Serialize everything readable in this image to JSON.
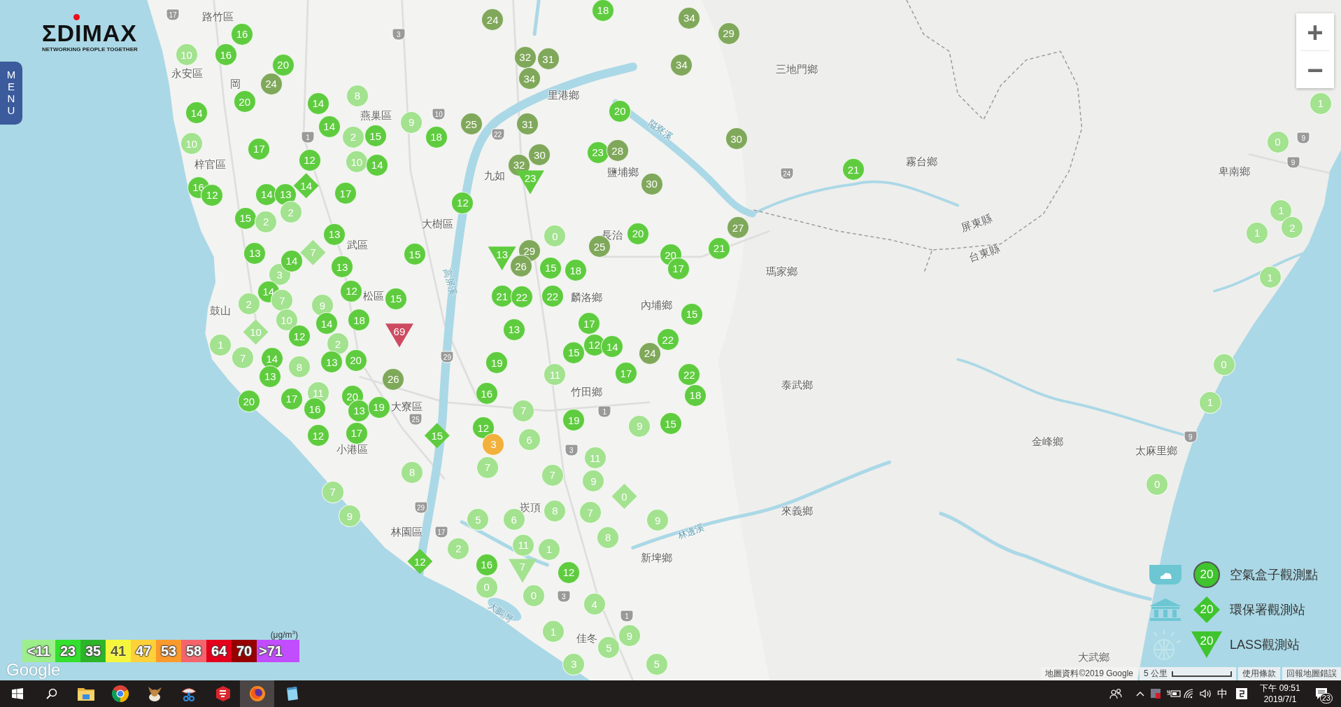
{
  "map": {
    "logo": {
      "wordmark": "ΣDIMAX",
      "tagline": "NETWORKING PEOPLE TOGETHER"
    },
    "menu_button": "MENU",
    "zoom": {
      "in": "+",
      "out": "−"
    },
    "place_labels": [
      "路竹區",
      "永安區",
      "岡",
      "燕巢區",
      "梓官區",
      "九如",
      "里港鄉",
      "鹽埔鄉",
      "三地門鄉",
      "霧台鄉",
      "卑南鄉",
      "大樹區",
      "武區",
      "長治",
      "瑪家鄉",
      "松區",
      "麟洛鄉",
      "內埔鄉",
      "鼓山",
      "泰武鄉",
      "竹田鄉",
      "大寮區",
      "小港區",
      "金峰鄉",
      "太麻里鄉",
      "來義鄉",
      "崁頂",
      "林園區",
      "新埤鄉",
      "佳冬",
      "大武鄉",
      "屏東縣",
      "台東縣"
    ],
    "water_labels": [
      "隘寮溪",
      "林邊溪",
      "大鵬灣",
      "高屏溪"
    ],
    "road_shields": [
      "17",
      "3",
      "10",
      "22",
      "1",
      "24",
      "9",
      "9",
      "29",
      "25",
      "29",
      "17",
      "1",
      "3",
      "1",
      "3",
      "9"
    ],
    "markers": [
      {
        "kind": "circle",
        "value": "16",
        "color": "#5fcc3f"
      },
      {
        "kind": "circle",
        "value": "24",
        "color": "#80a85b"
      },
      {
        "kind": "circle",
        "value": "18",
        "color": "#5fcc3f"
      },
      {
        "kind": "circle",
        "value": "34",
        "color": "#80a85b"
      },
      {
        "kind": "circle",
        "value": "29",
        "color": "#80a85b"
      },
      {
        "kind": "circle",
        "value": "10",
        "color": "#a3e28f"
      },
      {
        "kind": "circle",
        "value": "16",
        "color": "#5fcc3f"
      },
      {
        "kind": "circle",
        "value": "20",
        "color": "#5fcc3f"
      },
      {
        "kind": "circle",
        "value": "32",
        "color": "#80a85b"
      },
      {
        "kind": "circle",
        "value": "31",
        "color": "#80a85b"
      },
      {
        "kind": "circle",
        "value": "34",
        "color": "#80a85b"
      },
      {
        "kind": "circle",
        "value": "24",
        "color": "#80a85b"
      },
      {
        "kind": "circle",
        "value": "34",
        "color": "#80a85b"
      },
      {
        "kind": "circle",
        "value": "20",
        "color": "#5fcc3f"
      },
      {
        "kind": "circle",
        "value": "14",
        "color": "#5fcc3f"
      },
      {
        "kind": "circle",
        "value": "8",
        "color": "#a3e28f"
      },
      {
        "kind": "circle",
        "value": "14",
        "color": "#5fcc3f"
      },
      {
        "kind": "circle",
        "value": "10",
        "color": "#a3e28f"
      },
      {
        "kind": "circle",
        "value": "14",
        "color": "#5fcc3f"
      },
      {
        "kind": "circle",
        "value": "2",
        "color": "#a3e28f"
      },
      {
        "kind": "circle",
        "value": "15",
        "color": "#5fcc3f"
      },
      {
        "kind": "circle",
        "value": "9",
        "color": "#a3e28f"
      },
      {
        "kind": "circle",
        "value": "18",
        "color": "#5fcc3f"
      },
      {
        "kind": "circle",
        "value": "25",
        "color": "#80a85b"
      },
      {
        "kind": "circle",
        "value": "31",
        "color": "#80a85b"
      },
      {
        "kind": "circle",
        "value": "20",
        "color": "#5fcc3f"
      },
      {
        "kind": "circle",
        "value": "30",
        "color": "#80a85b"
      },
      {
        "kind": "circle",
        "value": "17",
        "color": "#5fcc3f"
      },
      {
        "kind": "circle",
        "value": "12",
        "color": "#5fcc3f"
      },
      {
        "kind": "circle",
        "value": "10",
        "color": "#a3e28f"
      },
      {
        "kind": "circle",
        "value": "14",
        "color": "#5fcc3f"
      },
      {
        "kind": "circle",
        "value": "32",
        "color": "#80a85b"
      },
      {
        "kind": "circle",
        "value": "30",
        "color": "#80a85b"
      },
      {
        "kind": "circle",
        "value": "23",
        "color": "#5fcc3f"
      },
      {
        "kind": "circle",
        "value": "28",
        "color": "#80a85b"
      },
      {
        "kind": "triangle",
        "value": "23",
        "color": "#5fcc3f"
      },
      {
        "kind": "circle",
        "value": "30",
        "color": "#80a85b"
      },
      {
        "kind": "circle",
        "value": "21",
        "color": "#5fcc3f"
      },
      {
        "kind": "circle",
        "value": "16",
        "color": "#5fcc3f"
      },
      {
        "kind": "circle",
        "value": "12",
        "color": "#5fcc3f"
      },
      {
        "kind": "circle",
        "value": "14",
        "color": "#5fcc3f"
      },
      {
        "kind": "circle",
        "value": "13",
        "color": "#5fcc3f"
      },
      {
        "kind": "diamond",
        "value": "14",
        "color": "#5fcc3f"
      },
      {
        "kind": "circle",
        "value": "17",
        "color": "#5fcc3f"
      },
      {
        "kind": "circle",
        "value": "12",
        "color": "#5fcc3f"
      },
      {
        "kind": "circle",
        "value": "15",
        "color": "#5fcc3f"
      },
      {
        "kind": "circle",
        "value": "2",
        "color": "#a3e28f"
      },
      {
        "kind": "circle",
        "value": "2",
        "color": "#a3e28f"
      },
      {
        "kind": "circle",
        "value": "13",
        "color": "#5fcc3f"
      },
      {
        "kind": "circle",
        "value": "0",
        "color": "#a3e28f"
      },
      {
        "kind": "circle",
        "value": "20",
        "color": "#5fcc3f"
      },
      {
        "kind": "circle",
        "value": "27",
        "color": "#80a85b"
      },
      {
        "kind": "circle",
        "value": "13",
        "color": "#5fcc3f"
      },
      {
        "kind": "circle",
        "value": "3",
        "color": "#a3e28f"
      },
      {
        "kind": "circle",
        "value": "14",
        "color": "#5fcc3f"
      },
      {
        "kind": "diamond",
        "value": "7",
        "color": "#a3e28f"
      },
      {
        "kind": "circle",
        "value": "13",
        "color": "#5fcc3f"
      },
      {
        "kind": "circle",
        "value": "15",
        "color": "#5fcc3f"
      },
      {
        "kind": "triangle",
        "value": "13",
        "color": "#5fcc3f"
      },
      {
        "kind": "circle",
        "value": "29",
        "color": "#80a85b"
      },
      {
        "kind": "circle",
        "value": "26",
        "color": "#80a85b"
      },
      {
        "kind": "circle",
        "value": "15",
        "color": "#5fcc3f"
      },
      {
        "kind": "circle",
        "value": "18",
        "color": "#5fcc3f"
      },
      {
        "kind": "circle",
        "value": "25",
        "color": "#80a85b"
      },
      {
        "kind": "circle",
        "value": "20",
        "color": "#5fcc3f"
      },
      {
        "kind": "circle",
        "value": "17",
        "color": "#5fcc3f"
      },
      {
        "kind": "circle",
        "value": "21",
        "color": "#5fcc3f"
      },
      {
        "kind": "circle",
        "value": "2",
        "color": "#a3e28f"
      },
      {
        "kind": "circle",
        "value": "14",
        "color": "#5fcc3f"
      },
      {
        "kind": "circle",
        "value": "7",
        "color": "#a3e28f"
      },
      {
        "kind": "circle",
        "value": "9",
        "color": "#a3e28f"
      },
      {
        "kind": "circle",
        "value": "12",
        "color": "#5fcc3f"
      },
      {
        "kind": "circle",
        "value": "15",
        "color": "#5fcc3f"
      },
      {
        "kind": "circle",
        "value": "21",
        "color": "#5fcc3f"
      },
      {
        "kind": "circle",
        "value": "22",
        "color": "#5fcc3f"
      },
      {
        "kind": "circle",
        "value": "22",
        "color": "#5fcc3f"
      },
      {
        "kind": "circle",
        "value": "10",
        "color": "#a3e28f"
      },
      {
        "kind": "circle",
        "value": "14",
        "color": "#5fcc3f"
      },
      {
        "kind": "circle",
        "value": "18",
        "color": "#5fcc3f"
      },
      {
        "kind": "triangle",
        "value": "69",
        "color": "#cd4a60"
      },
      {
        "kind": "circle",
        "value": "13",
        "color": "#5fcc3f"
      },
      {
        "kind": "circle",
        "value": "17",
        "color": "#5fcc3f"
      },
      {
        "kind": "circle",
        "value": "15",
        "color": "#5fcc3f"
      },
      {
        "kind": "circle",
        "value": "1",
        "color": "#a3e28f"
      },
      {
        "kind": "circle",
        "value": "7",
        "color": "#a3e28f"
      },
      {
        "kind": "diamond",
        "value": "10",
        "color": "#a3e28f"
      },
      {
        "kind": "circle",
        "value": "14",
        "color": "#5fcc3f"
      },
      {
        "kind": "circle",
        "value": "12",
        "color": "#5fcc3f"
      },
      {
        "kind": "circle",
        "value": "8",
        "color": "#a3e28f"
      },
      {
        "kind": "circle",
        "value": "2",
        "color": "#a3e28f"
      },
      {
        "kind": "circle",
        "value": "13",
        "color": "#5fcc3f"
      },
      {
        "kind": "circle",
        "value": "20",
        "color": "#5fcc3f"
      },
      {
        "kind": "circle",
        "value": "19",
        "color": "#5fcc3f"
      },
      {
        "kind": "circle",
        "value": "15",
        "color": "#5fcc3f"
      },
      {
        "kind": "circle",
        "value": "12",
        "color": "#5fcc3f"
      },
      {
        "kind": "circle",
        "value": "14",
        "color": "#5fcc3f"
      },
      {
        "kind": "circle",
        "value": "24",
        "color": "#80a85b"
      },
      {
        "kind": "circle",
        "value": "22",
        "color": "#5fcc3f"
      },
      {
        "kind": "circle",
        "value": "13",
        "color": "#5fcc3f"
      },
      {
        "kind": "circle",
        "value": "26",
        "color": "#80a85b"
      },
      {
        "kind": "circle",
        "value": "11",
        "color": "#a3e28f"
      },
      {
        "kind": "circle",
        "value": "17",
        "color": "#5fcc3f"
      },
      {
        "kind": "circle",
        "value": "22",
        "color": "#5fcc3f"
      },
      {
        "kind": "circle",
        "value": "20",
        "color": "#5fcc3f"
      },
      {
        "kind": "circle",
        "value": "17",
        "color": "#5fcc3f"
      },
      {
        "kind": "circle",
        "value": "11",
        "color": "#a3e28f"
      },
      {
        "kind": "circle",
        "value": "16",
        "color": "#5fcc3f"
      },
      {
        "kind": "circle",
        "value": "20",
        "color": "#5fcc3f"
      },
      {
        "kind": "circle",
        "value": "13",
        "color": "#5fcc3f"
      },
      {
        "kind": "circle",
        "value": "19",
        "color": "#5fcc3f"
      },
      {
        "kind": "circle",
        "value": "16",
        "color": "#5fcc3f"
      },
      {
        "kind": "circle",
        "value": "7",
        "color": "#a3e28f"
      },
      {
        "kind": "circle",
        "value": "18",
        "color": "#5fcc3f"
      },
      {
        "kind": "circle",
        "value": "12",
        "color": "#5fcc3f"
      },
      {
        "kind": "circle",
        "value": "17",
        "color": "#5fcc3f"
      },
      {
        "kind": "diamond",
        "value": "15",
        "color": "#5fcc3f"
      },
      {
        "kind": "circle",
        "value": "12",
        "color": "#5fcc3f"
      },
      {
        "kind": "circle",
        "value": "3",
        "color": "#f2b03c"
      },
      {
        "kind": "circle",
        "value": "6",
        "color": "#a3e28f"
      },
      {
        "kind": "circle",
        "value": "19",
        "color": "#5fcc3f"
      },
      {
        "kind": "circle",
        "value": "9",
        "color": "#a3e28f"
      },
      {
        "kind": "circle",
        "value": "15",
        "color": "#5fcc3f"
      },
      {
        "kind": "circle",
        "value": "11",
        "color": "#a3e28f"
      },
      {
        "kind": "circle",
        "value": "8",
        "color": "#a3e28f"
      },
      {
        "kind": "circle",
        "value": "7",
        "color": "#a3e28f"
      },
      {
        "kind": "circle",
        "value": "7",
        "color": "#a3e28f"
      },
      {
        "kind": "circle",
        "value": "9",
        "color": "#a3e28f"
      },
      {
        "kind": "circle",
        "value": "7",
        "color": "#a3e28f"
      },
      {
        "kind": "diamond",
        "value": "0",
        "color": "#a3e28f"
      },
      {
        "kind": "circle",
        "value": "9",
        "color": "#a3e28f"
      },
      {
        "kind": "circle",
        "value": "5",
        "color": "#a3e28f"
      },
      {
        "kind": "circle",
        "value": "6",
        "color": "#a3e28f"
      },
      {
        "kind": "circle",
        "value": "8",
        "color": "#a3e28f"
      },
      {
        "kind": "circle",
        "value": "7",
        "color": "#a3e28f"
      },
      {
        "kind": "circle",
        "value": "9",
        "color": "#a3e28f"
      },
      {
        "kind": "circle",
        "value": "2",
        "color": "#a3e28f"
      },
      {
        "kind": "circle",
        "value": "11",
        "color": "#a3e28f"
      },
      {
        "kind": "circle",
        "value": "1",
        "color": "#a3e28f"
      },
      {
        "kind": "circle",
        "value": "8",
        "color": "#a3e28f"
      },
      {
        "kind": "diamond",
        "value": "12",
        "color": "#5fcc3f"
      },
      {
        "kind": "circle",
        "value": "16",
        "color": "#5fcc3f"
      },
      {
        "kind": "triangle",
        "value": "7",
        "color": "#a3e28f"
      },
      {
        "kind": "circle",
        "value": "12",
        "color": "#5fcc3f"
      },
      {
        "kind": "circle",
        "value": "0",
        "color": "#a3e28f"
      },
      {
        "kind": "circle",
        "value": "0",
        "color": "#a3e28f"
      },
      {
        "kind": "circle",
        "value": "4",
        "color": "#a3e28f"
      },
      {
        "kind": "circle",
        "value": "1",
        "color": "#a3e28f"
      },
      {
        "kind": "circle",
        "value": "5",
        "color": "#a3e28f"
      },
      {
        "kind": "circle",
        "value": "9",
        "color": "#a3e28f"
      },
      {
        "kind": "circle",
        "value": "3",
        "color": "#a3e28f"
      },
      {
        "kind": "circle",
        "value": "5",
        "color": "#a3e28f"
      },
      {
        "kind": "circle",
        "value": "1",
        "color": "#a3e28f"
      },
      {
        "kind": "circle",
        "value": "0",
        "color": "#a3e28f"
      },
      {
        "kind": "circle",
        "value": "1",
        "color": "#a3e28f"
      },
      {
        "kind": "circle",
        "value": "1",
        "color": "#a3e28f"
      },
      {
        "kind": "circle",
        "value": "2",
        "color": "#a3e28f"
      },
      {
        "kind": "circle",
        "value": "1",
        "color": "#a3e28f"
      },
      {
        "kind": "circle",
        "value": "0",
        "color": "#a3e28f"
      },
      {
        "kind": "circle",
        "value": "1",
        "color": "#a3e28f"
      },
      {
        "kind": "circle",
        "value": "0",
        "color": "#a3e28f"
      }
    ],
    "scale_legend": {
      "unit": "(μg/m$^{3}$)",
      "levels": [
        {
          "label": "<11",
          "color": "#9cef8a"
        },
        {
          "label": "23",
          "color": "#34e02e"
        },
        {
          "label": "35",
          "color": "#2db52a"
        },
        {
          "label": "41",
          "color": "#f5f53c"
        },
        {
          "label": "47",
          "color": "#fdd13a"
        },
        {
          "label": "53",
          "color": "#fb9a2c"
        },
        {
          "label": "58",
          "color": "#f4646c"
        },
        {
          "label": "64",
          "color": "#e4001c"
        },
        {
          "label": "70",
          "color": "#980000"
        },
        {
          "label": ">71",
          "color": "#c24dff"
        }
      ]
    },
    "google_logo": "Google",
    "station_legend": [
      {
        "kind": "airbox",
        "value": "20",
        "color": "#3fc42e",
        "label": "空氣盒子觀測點"
      },
      {
        "kind": "epa",
        "value": "20",
        "color": "#3fc42e",
        "label": "環保署觀測站"
      },
      {
        "kind": "lass",
        "value": "20",
        "color": "#3fc42e",
        "label": "LASS觀測站"
      }
    ],
    "attribution": {
      "map_data": "地圖資料©2019 Google",
      "scale": "5 公里",
      "terms": "使用條款",
      "report": "回報地圖錯誤"
    }
  },
  "taskbar": {
    "apps": [
      {
        "kind": "explorer",
        "selected": false
      },
      {
        "kind": "chrome",
        "selected": false
      },
      {
        "kind": "bird",
        "selected": false
      },
      {
        "kind": "snip",
        "selected": false
      },
      {
        "kind": "sketchup",
        "selected": false
      },
      {
        "kind": "firefox",
        "selected": true
      },
      {
        "kind": "notepad",
        "selected": false
      }
    ],
    "tray": {
      "input_mode": "中",
      "time": "下午 09:51",
      "date": "2019/7/1",
      "notifications": "23"
    }
  }
}
